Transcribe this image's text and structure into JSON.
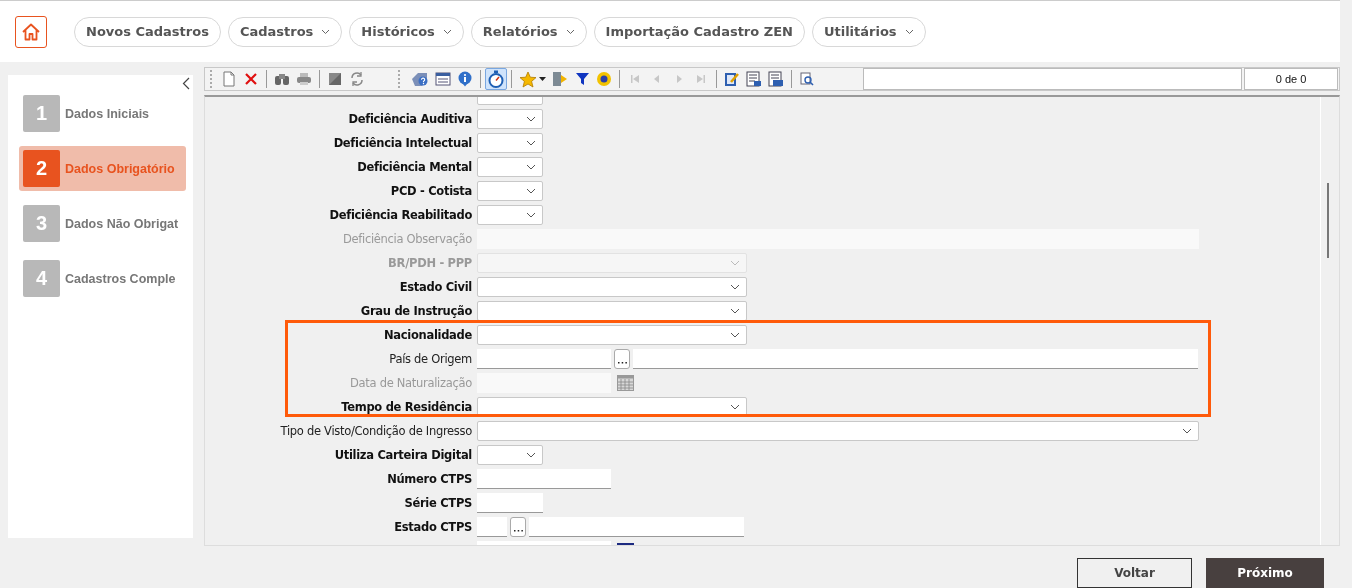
{
  "nav": {
    "items": [
      {
        "label": "Novos Cadastros",
        "has_menu": false
      },
      {
        "label": "Cadastros",
        "has_menu": true
      },
      {
        "label": "Históricos",
        "has_menu": true
      },
      {
        "label": "Relatórios",
        "has_menu": true
      },
      {
        "label": "Importação Cadastro ZEN",
        "has_menu": false
      },
      {
        "label": "Utilitários",
        "has_menu": true
      }
    ]
  },
  "steps": [
    {
      "number": "1",
      "label": "Dados Iniciais",
      "selected": false
    },
    {
      "number": "2",
      "label": "Dados Obrigatório",
      "selected": true
    },
    {
      "number": "3",
      "label": "Dados Não Obrigat",
      "selected": false
    },
    {
      "number": "4",
      "label": "Cadastros Comple",
      "selected": false
    }
  ],
  "toolbar": {
    "tools": [
      {
        "kind": "new",
        "pressed": false,
        "disabled": false
      },
      {
        "kind": "delete",
        "pressed": false,
        "disabled": false
      },
      {
        "kind": "separator"
      },
      {
        "kind": "find",
        "pressed": false,
        "disabled": false
      },
      {
        "kind": "print",
        "pressed": false,
        "disabled": false
      },
      {
        "kind": "separator"
      },
      {
        "kind": "square",
        "pressed": false,
        "disabled": false
      },
      {
        "kind": "refresh",
        "pressed": false,
        "disabled": false
      },
      {
        "kind": "grip"
      },
      {
        "kind": "help",
        "pressed": false,
        "disabled": false
      },
      {
        "kind": "form",
        "pressed": false,
        "disabled": false
      },
      {
        "kind": "info",
        "pressed": false,
        "disabled": false
      },
      {
        "kind": "separator"
      },
      {
        "kind": "timer",
        "pressed": true,
        "disabled": false
      },
      {
        "kind": "separator"
      },
      {
        "kind": "favorite",
        "pressed": false,
        "disabled": false
      },
      {
        "kind": "exit",
        "pressed": false,
        "disabled": false
      },
      {
        "kind": "filter",
        "pressed": false,
        "disabled": false
      },
      {
        "kind": "sync",
        "pressed": false,
        "disabled": false
      },
      {
        "kind": "separator"
      },
      {
        "kind": "first",
        "pressed": false,
        "disabled": true
      },
      {
        "kind": "previous",
        "pressed": false,
        "disabled": true
      },
      {
        "kind": "next",
        "pressed": false,
        "disabled": true
      },
      {
        "kind": "last",
        "pressed": false,
        "disabled": true
      },
      {
        "kind": "separator"
      },
      {
        "kind": "edit",
        "pressed": false,
        "disabled": false
      },
      {
        "kind": "report",
        "pressed": false,
        "disabled": false
      },
      {
        "kind": "reportlist",
        "pressed": false,
        "disabled": false
      },
      {
        "kind": "separator"
      },
      {
        "kind": "preview",
        "pressed": false,
        "disabled": false
      }
    ],
    "counter": "0 de 0"
  },
  "form": {
    "sections": [
      {
        "kind": "plain",
        "rows": [
          {
            "kind": "shortselect"
          },
          {
            "label": "Deficiência Auditiva",
            "required": true,
            "disabled": false,
            "kind": "shortselect"
          },
          {
            "label": "Deficiência Intelectual",
            "required": true,
            "disabled": false,
            "kind": "shortselect"
          },
          {
            "label": "Deficiência Mental",
            "required": true,
            "disabled": false,
            "kind": "shortselect"
          },
          {
            "label": "PCD - Cotista",
            "required": true,
            "disabled": false,
            "kind": "shortselect"
          },
          {
            "label": "Deficiência Reabilitado",
            "required": true,
            "disabled": false,
            "kind": "shortselect"
          },
          {
            "label": "Deficiência Observação",
            "required": false,
            "disabled": true,
            "kind": "longtext"
          },
          {
            "label": "BR/PDH - PPP",
            "required": true,
            "disabled": true,
            "kind": "select"
          },
          {
            "label": "Estado Civil",
            "required": true,
            "disabled": false,
            "kind": "select"
          },
          {
            "label": "Grau de Instrução",
            "required": true,
            "disabled": false,
            "kind": "select"
          }
        ]
      },
      {
        "kind": "highlighted",
        "rows": [
          {
            "label": "Nacionalidade",
            "required": true,
            "disabled": false,
            "kind": "select"
          },
          {
            "label": "País de Origem",
            "required": false,
            "disabled": false,
            "kind": "lookup"
          },
          {
            "label": "Data de Naturalização",
            "required": false,
            "disabled": true,
            "kind": "date"
          },
          {
            "label": "Tempo de Residência",
            "required": true,
            "disabled": false,
            "kind": "select"
          }
        ]
      },
      {
        "kind": "plain",
        "rows": [
          {
            "label": "Tipo de Visto/Condição de Ingresso",
            "required": false,
            "disabled": false,
            "kind": "longselect"
          },
          {
            "label": "Utiliza Carteira Digital",
            "required": true,
            "disabled": false,
            "kind": "shortselect"
          },
          {
            "label": "Número CTPS",
            "required": true,
            "disabled": false,
            "kind": "text"
          },
          {
            "label": "Série CTPS",
            "required": true,
            "disabled": false,
            "kind": "shorttext"
          },
          {
            "label": "Estado CTPS",
            "required": true,
            "disabled": false,
            "kind": "shortlookup"
          },
          {
            "kind": "date"
          }
        ]
      }
    ]
  },
  "buttons": [
    {
      "label": "Voltar",
      "primary": false
    },
    {
      "label": "Próximo",
      "primary": true
    }
  ]
}
